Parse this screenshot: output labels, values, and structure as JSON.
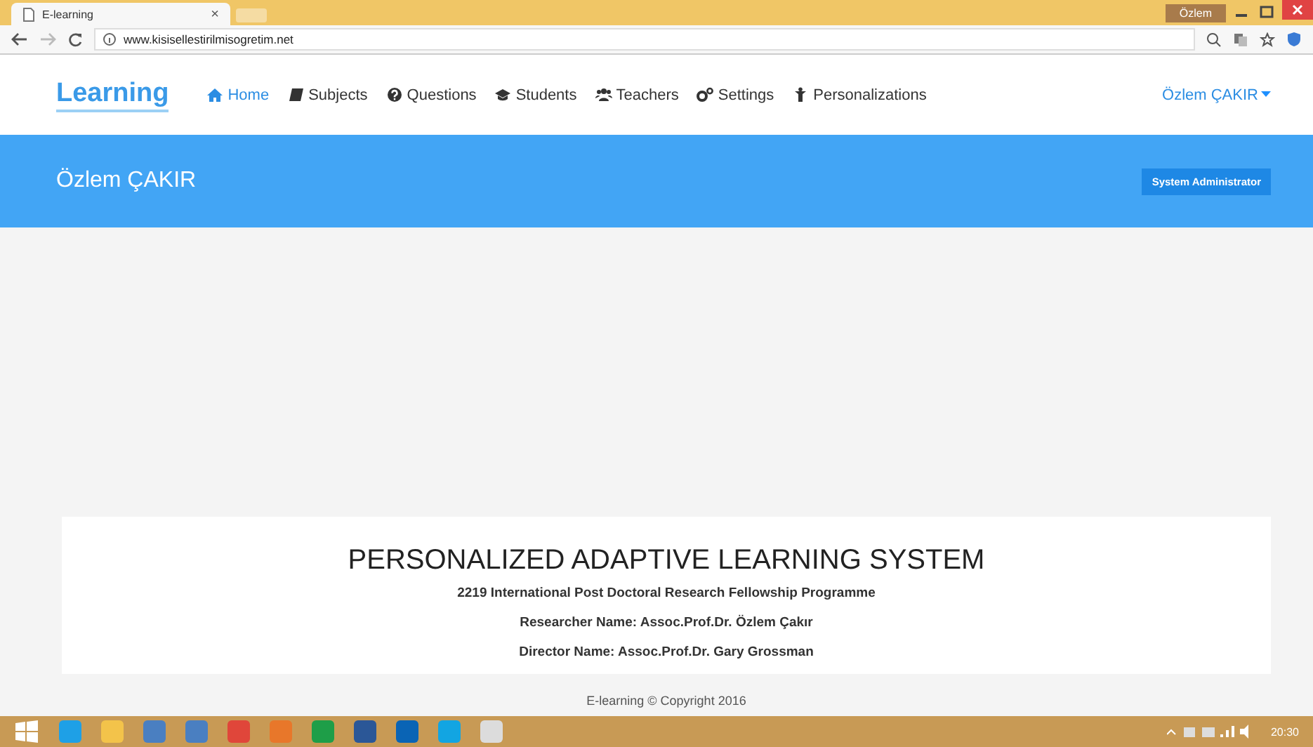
{
  "browser": {
    "tab_title": "E-learning",
    "tab_close": "×",
    "profile": "Özlem",
    "url": "www.kisisellestirilmisogretim.net"
  },
  "navbar": {
    "brand": "Learning",
    "items": [
      {
        "label": "Home",
        "selected": true
      },
      {
        "label": "Subjects",
        "selected": false
      },
      {
        "label": "Questions",
        "selected": false
      },
      {
        "label": "Students",
        "selected": false
      },
      {
        "label": "Teachers",
        "selected": false
      },
      {
        "label": "Settings",
        "selected": false
      },
      {
        "label": "Personalizations",
        "selected": false
      }
    ],
    "user": "Özlem ÇAKIR"
  },
  "banner": {
    "name": "Özlem ÇAKIR",
    "role": "System Administrator"
  },
  "card": {
    "title": "PERSONALIZED ADAPTIVE LEARNING SYSTEM",
    "lines": [
      "2219 International Post Doctoral Research Fellowship Programme",
      "Researcher Name: Assoc.Prof.Dr. Özlem Çakır",
      "Director Name: Assoc.Prof.Dr. Gary Grossman"
    ]
  },
  "footer": "E-learning © Copyright 2016",
  "taskbar": {
    "clock": "20:30"
  }
}
